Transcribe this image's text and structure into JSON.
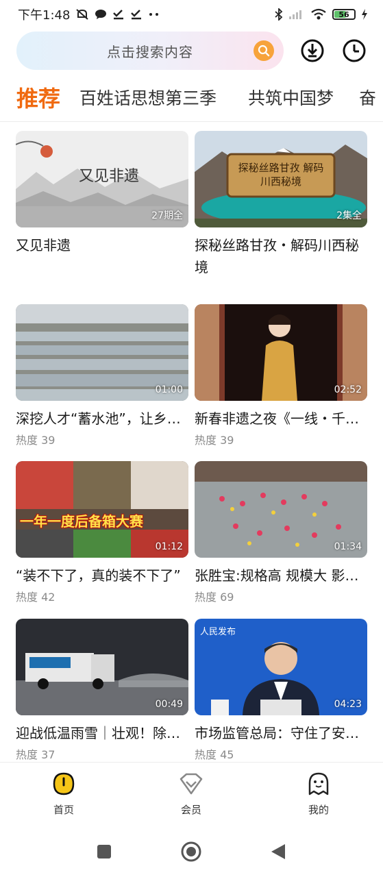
{
  "status_bar": {
    "time": "下午1:48",
    "battery_level": "56"
  },
  "search": {
    "placeholder": "点击搜索内容"
  },
  "tabs": [
    {
      "label": "推荐"
    },
    {
      "label": "百姓话思想第三季"
    },
    {
      "label": "共筑中国梦"
    },
    {
      "label": "奋"
    }
  ],
  "cards": [
    {
      "title": "又见非遗",
      "badge": "27期全",
      "heat": "",
      "thumb_text": "又见非遗"
    },
    {
      "title": "探秘丝路甘孜・解码川西秘境",
      "badge": "2集全",
      "heat": "",
      "thumb_text": "探秘丝路甘孜 解码川西秘境"
    },
    {
      "title": "深挖人才“蓄水池”，让乡村振兴有效衔接",
      "badge": "01:00",
      "heat": "热度 39"
    },
    {
      "title": "新春非遗之夜《一线・千年》",
      "badge": "02:52",
      "heat": "热度 39"
    },
    {
      "title": "“装不下了，真的装不下了”",
      "badge": "01:12",
      "heat": "热度 42",
      "thumb_text": "一年一度后备箱大赛"
    },
    {
      "title": "张胜宝:规格高 规模大 影响深远",
      "badge": "01:34",
      "heat": "热度 69"
    },
    {
      "title": "迎战低温雨雪｜壮观！除雪车出动",
      "badge": "00:49",
      "heat": "热度 37"
    },
    {
      "title": "市场监管总局：守住了安全底线",
      "badge": "04:23",
      "heat": "热度 45",
      "thumb_text": "人民发布"
    }
  ],
  "bottom_nav": [
    {
      "label": "首页",
      "icon": "home-icon",
      "active": true
    },
    {
      "label": "会员",
      "icon": "vip-icon",
      "active": false
    },
    {
      "label": "我的",
      "icon": "profile-icon",
      "active": false
    }
  ],
  "colors": {
    "accent": "#f06a10",
    "search_button": "#f7a33b",
    "nav_active": "#f5c518"
  }
}
